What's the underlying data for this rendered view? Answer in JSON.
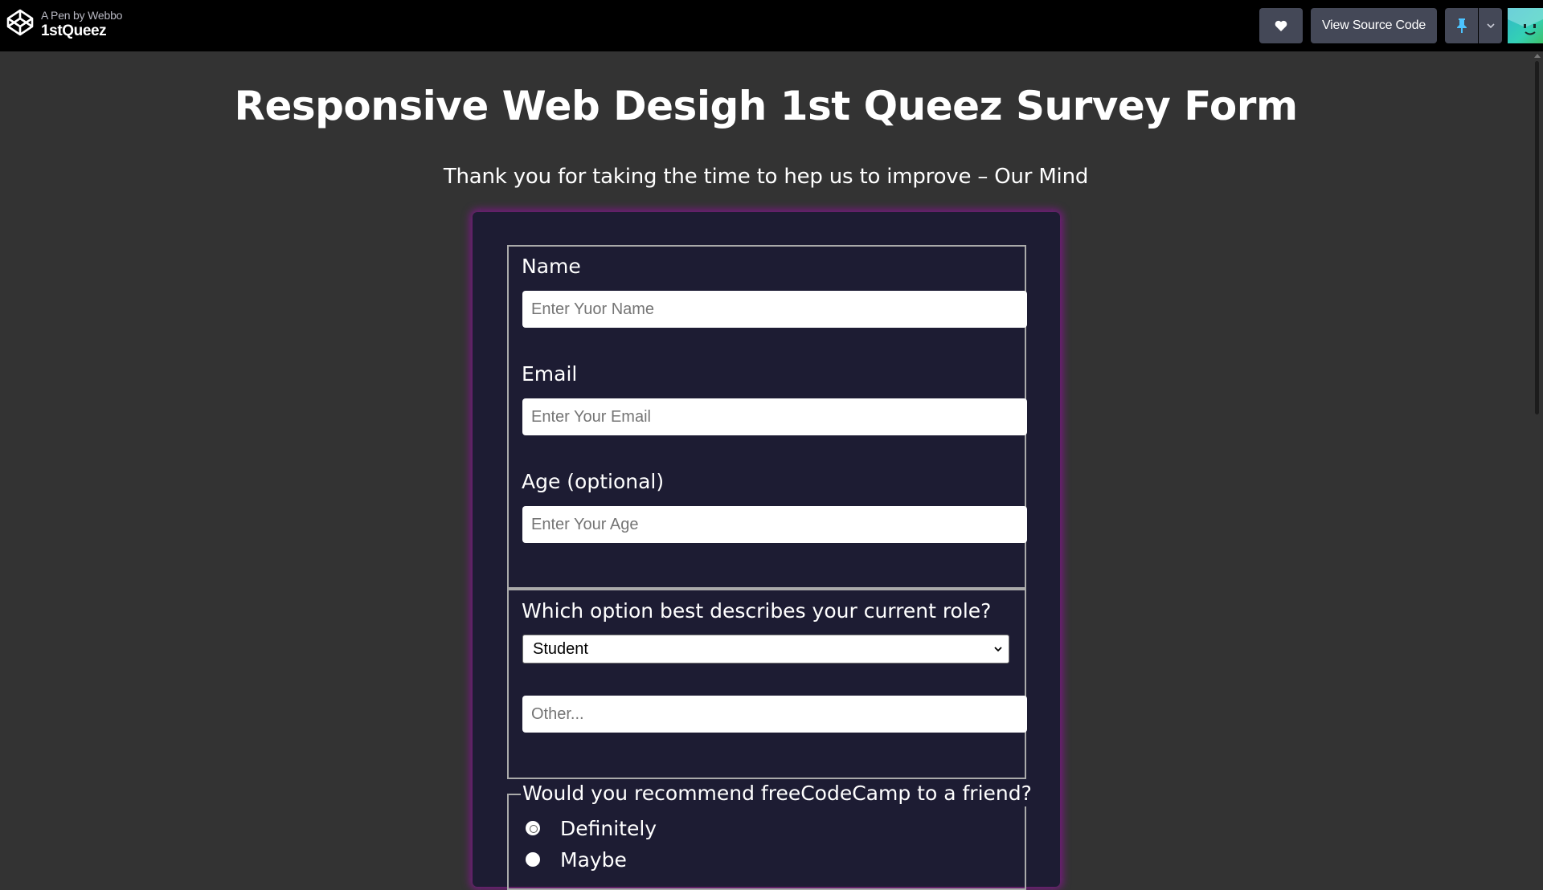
{
  "header": {
    "pen_by": "A Pen by Webbo",
    "pen_title": "1stQueez",
    "view_source_label": "View Source Code",
    "heart_icon": "heart-icon",
    "pin_icon": "pin-icon",
    "caret_icon": "chevron-down-icon"
  },
  "page": {
    "title": "Responsive Web Desigh 1st Queez Survey Form",
    "subtitle": "Thank you for taking the time to hep us to improve – Our Mind"
  },
  "form": {
    "name": {
      "label": "Name",
      "placeholder": "Enter Yuor Name",
      "value": ""
    },
    "email": {
      "label": "Email",
      "placeholder": "Enter Your Email",
      "value": ""
    },
    "age": {
      "label": "Age (optional)",
      "placeholder": "Enter Your Age",
      "value": ""
    },
    "role": {
      "label": "Which option best describes your current role?",
      "selected": "Student"
    },
    "other": {
      "placeholder": "Other...",
      "value": ""
    },
    "recommend": {
      "legend": "Would you recommend freeCodeCamp to a friend?",
      "options": [
        {
          "label": "Definitely",
          "checked": true
        },
        {
          "label": "Maybe",
          "checked": false
        }
      ]
    }
  },
  "colors": {
    "page_bg": "#333333",
    "topbar_bg": "#000000",
    "card_bg": "#1d1c33",
    "card_glow": "#7b1a85",
    "button_bg": "#444857",
    "pin_accent": "#47cf73"
  }
}
